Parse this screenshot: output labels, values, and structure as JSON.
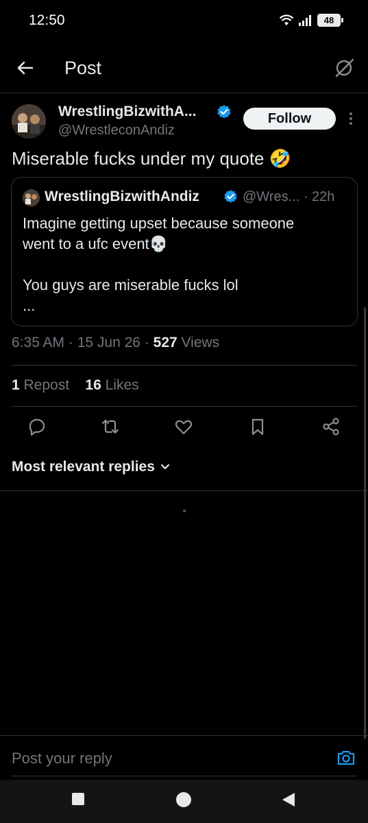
{
  "status_bar": {
    "time": "12:50",
    "battery": "48"
  },
  "header": {
    "title": "Post"
  },
  "author": {
    "display_name": "WrestlingBizwithA...",
    "handle": "@WrestleconAndiz",
    "follow_label": "Follow"
  },
  "post": {
    "text": "Miserable fucks under my quote 🤣"
  },
  "quote": {
    "display_name": "WrestlingBizwithAndiz",
    "meta": "@Wres... · 22h",
    "text": "Imagine getting upset because someone\nwent to a ufc event💀\n\nYou guys are miserable fucks lol\n..."
  },
  "meta": {
    "time": "6:35 AM",
    "date": "15 Jun 26",
    "views_count": "527",
    "views_label": "Views"
  },
  "engagement": {
    "reposts_count": "1",
    "reposts_label": "Repost",
    "likes_count": "16",
    "likes_label": "Likes"
  },
  "replies": {
    "sort_label": "Most relevant replies"
  },
  "reply_bar": {
    "placeholder": "Post your reply"
  },
  "colors": {
    "verified": "#1d9bf0",
    "background": "#000000",
    "muted": "#71767b",
    "text": "#e7e9ea"
  },
  "icons": [
    "back-arrow-icon",
    "grok-icon",
    "verified-icon",
    "more-icon",
    "reply-icon",
    "repost-icon",
    "like-icon",
    "bookmark-icon",
    "share-icon",
    "chevron-down-icon",
    "camera-icon",
    "wifi-icon",
    "signal-icon"
  ]
}
